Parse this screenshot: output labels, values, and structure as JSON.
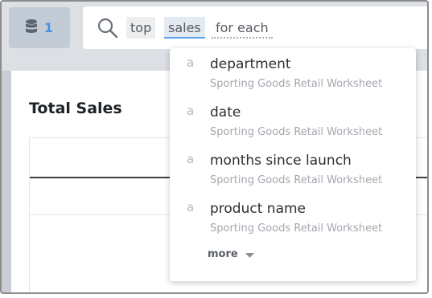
{
  "source_button": {
    "count": "1",
    "icon": "database-icon"
  },
  "search": {
    "icon": "search-icon",
    "tokens": [
      "top",
      "sales",
      "for each"
    ]
  },
  "card": {
    "title": "Total Sales"
  },
  "suggestions": {
    "items": [
      {
        "type": "a",
        "name": "department",
        "source": "Sporting Goods Retail Worksheet"
      },
      {
        "type": "a",
        "name": "date",
        "source": "Sporting Goods Retail Worksheet"
      },
      {
        "type": "a",
        "name": "months since launch",
        "source": "Sporting Goods Retail Worksheet"
      },
      {
        "type": "a",
        "name": "product name",
        "source": "Sporting Goods Retail Worksheet"
      }
    ],
    "more_label": "more"
  },
  "colors": {
    "accent": "#4a90e2",
    "token_underline": "#5aa3e8",
    "background": "#c9cdd3"
  }
}
